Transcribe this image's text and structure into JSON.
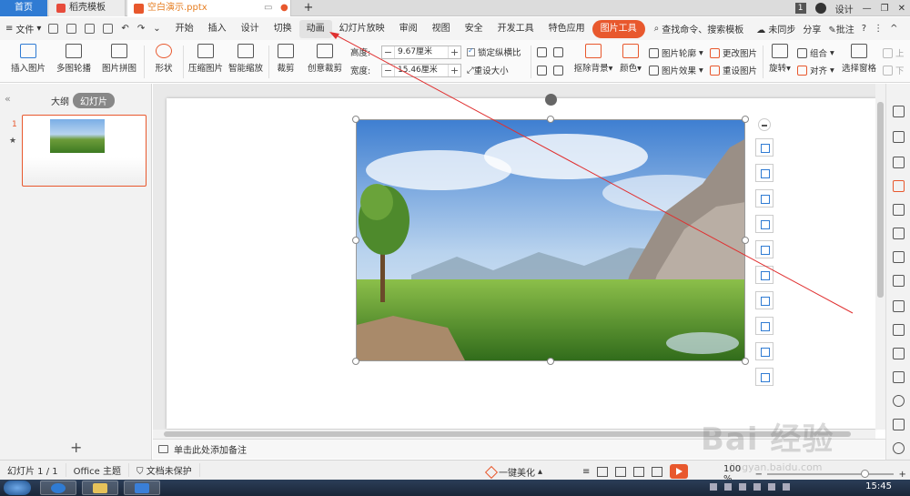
{
  "tabs": {
    "home": "首页",
    "template": "稻壳模板",
    "doc": "空白演示.pptx"
  },
  "titlebar": {
    "count": "1",
    "design": "设计"
  },
  "menubar": {
    "file": "文件",
    "ribbon_tabs": [
      "开始",
      "插入",
      "设计",
      "切换",
      "动画",
      "幻灯片放映",
      "审阅",
      "视图",
      "安全",
      "开发工具",
      "特色应用",
      "图片工具"
    ],
    "search": "查找命令、搜索模板",
    "sync": "未同步",
    "share": "分享",
    "comment": "批注"
  },
  "ribbon": {
    "insert_picture": "插入图片",
    "multi_outline": "多图轮播",
    "picture_collage": "图片拼图",
    "shape": "形状",
    "compress": "压缩图片",
    "smart_scale": "智能缩放",
    "crop": "裁剪",
    "creative_crop": "创意裁剪",
    "height_label": "高度:",
    "height_value": "9.67厘米",
    "width_label": "宽度:",
    "width_value": "15.46厘米",
    "lock_ratio": "锁定纵横比",
    "reset_size": "重设大小",
    "remove_bg": "抠除背景",
    "color": "颜色",
    "picture_outline": "图片轮廓",
    "picture_effect": "图片效果",
    "change_picture": "更改图片",
    "reset_picture": "重设图片",
    "rotate": "旋转",
    "group": "组合",
    "align": "对齐",
    "selection_pane": "选择窗格",
    "bring_up": "上",
    "send_down": "下"
  },
  "leftpanel": {
    "outline_tab": "大纲",
    "slides_tab": "幻灯片",
    "slide_number": "1",
    "star": "★",
    "add": "+"
  },
  "notes": {
    "placeholder": "单击此处添加备注"
  },
  "statusbar": {
    "slide_info": "幻灯片 1 / 1",
    "theme": "Office 主题",
    "protection": "文档未保护",
    "beautify": "一键美化",
    "zoom": "100 %",
    "zoom_minus": "−",
    "zoom_plus": "+"
  },
  "taskbar": {
    "time": "15:45"
  },
  "watermark": {
    "brand": "Bai 经验",
    "url": "jingyan.baidu.com"
  },
  "colors": {
    "accent": "#e8582d",
    "home_tab": "#2f7bd3",
    "arrow": "#e03030"
  }
}
